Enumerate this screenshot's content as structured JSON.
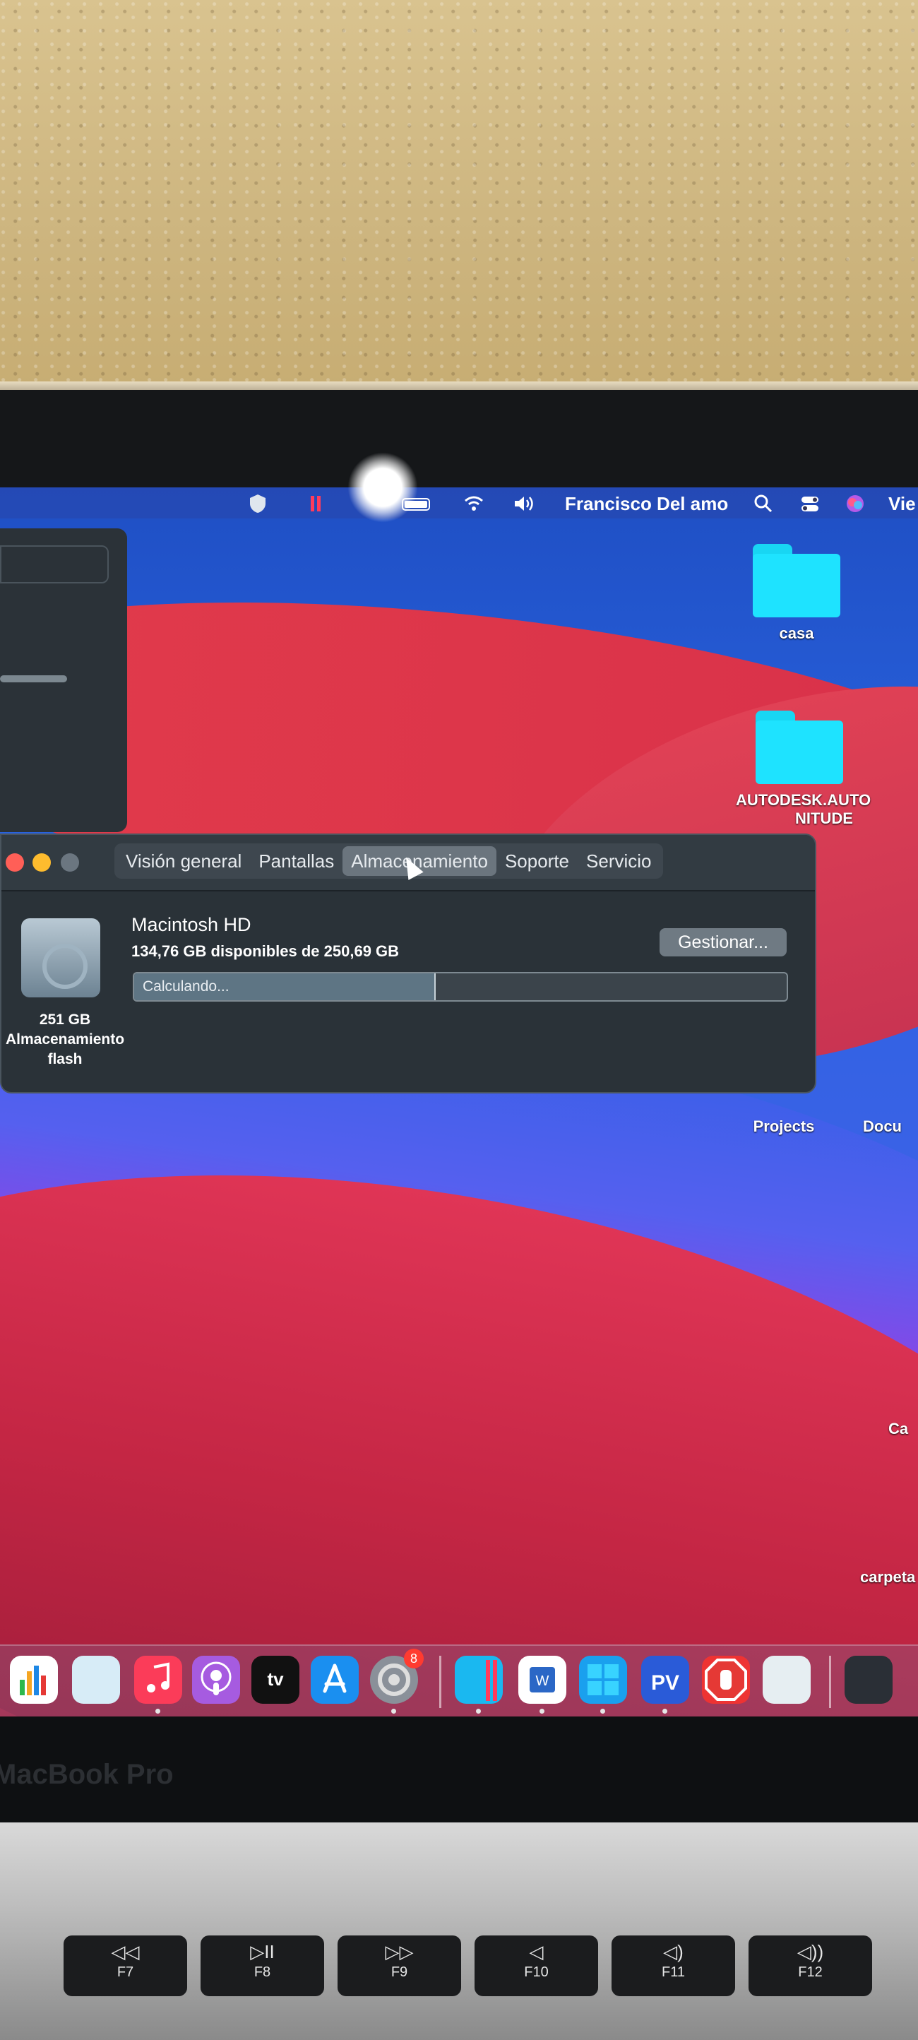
{
  "menubar": {
    "user_name": "Francisco Del amo",
    "truncated_item": "Vie",
    "icons": [
      "shield-icon",
      "pause-icon",
      "battery-icon",
      "wifi-icon",
      "volume-icon",
      "search-icon",
      "control-center-icon",
      "siri-icon"
    ]
  },
  "desktop": {
    "folders": [
      {
        "label": "casa"
      },
      {
        "label": "AUTODESK.AUTO"
      },
      {
        "label": "NITUDE"
      },
      {
        "label": "Projects"
      },
      {
        "label": "Docu"
      },
      {
        "label": "Ca"
      },
      {
        "label": "carpeta"
      }
    ]
  },
  "about_window": {
    "tabs": [
      {
        "label": "Visión general",
        "active": false
      },
      {
        "label": "Pantallas",
        "active": false
      },
      {
        "label": "Almacenamiento",
        "active": true
      },
      {
        "label": "Soporte",
        "active": false
      },
      {
        "label": "Servicio",
        "active": false
      }
    ],
    "disk_caption_line1": "251 GB",
    "disk_caption_line2": "Almacenamiento",
    "disk_caption_line3": "flash",
    "volume_name": "Macintosh HD",
    "volume_free": "134,76 GB disponibles de 250,69 GB",
    "manage_button": "Gestionar...",
    "progress_label": "Calculando...",
    "progress_fraction": 0.46
  },
  "dock": {
    "apps": [
      "numbers-icon",
      "keynote-icon",
      "music-icon",
      "podcasts-icon",
      "apple-tv-icon",
      "app-store-icon",
      "system-preferences-icon",
      "parallels-icon",
      "word-icon",
      "windows-icon",
      "parallels-pv-icon",
      "adblock-icon",
      "preview-icon",
      "desktop-stack-icon"
    ],
    "system_preferences_badge": "8",
    "apple_tv_label": "tv"
  },
  "laptop": {
    "brand": "MacBook Pro",
    "keys": [
      {
        "symbol": "◁◁",
        "label": "F7"
      },
      {
        "symbol": "▷II",
        "label": "F8"
      },
      {
        "symbol": "▷▷",
        "label": "F9"
      },
      {
        "symbol": "◁",
        "label": "F10"
      },
      {
        "symbol": "◁)",
        "label": "F11"
      },
      {
        "symbol": "◁))",
        "label": "F12"
      }
    ]
  },
  "colors": {
    "folder": "#1ee3ff",
    "window_bg": "#2a3238",
    "close": "#ff5f57",
    "minimize": "#febc2e",
    "zoom_inactive": "#6b7680"
  }
}
